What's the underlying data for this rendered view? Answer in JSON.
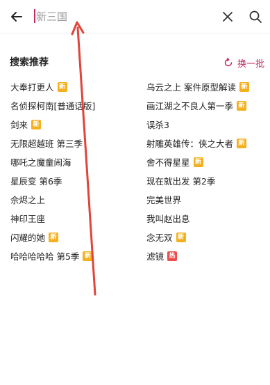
{
  "search": {
    "value": "",
    "placeholder": "新三国"
  },
  "section": {
    "title": "搜索推荐",
    "refresh_label": "换一批"
  },
  "colors": {
    "accent": "#c62860",
    "new_badge": "#f5b01e",
    "hot_badge": "#ef4b4b",
    "annotation_arrow": "#e0443a"
  },
  "recommendations": [
    {
      "left": {
        "title": "大奉打更人",
        "badge": "新"
      },
      "right": {
        "title": "乌云之上 案件原型解读",
        "badge": "新"
      }
    },
    {
      "left": {
        "title": "名侦探柯南[普通话版]",
        "badge": ""
      },
      "right": {
        "title": "画江湖之不良人第一季",
        "badge": "新"
      }
    },
    {
      "left": {
        "title": "剑来",
        "badge": "新"
      },
      "right": {
        "title": "误杀3",
        "badge": ""
      }
    },
    {
      "left": {
        "title": "无限超越班 第三季",
        "badge": ""
      },
      "right": {
        "title": "射雕英雄传：侠之大者",
        "badge": "新"
      }
    },
    {
      "left": {
        "title": "哪吒之魔童闹海",
        "badge": ""
      },
      "right": {
        "title": "舍不得星星",
        "badge": "新"
      }
    },
    {
      "left": {
        "title": "星辰变 第6季",
        "badge": ""
      },
      "right": {
        "title": "现在就出发 第2季",
        "badge": ""
      }
    },
    {
      "left": {
        "title": "佘烬之上",
        "badge": ""
      },
      "right": {
        "title": "完美世界",
        "badge": ""
      }
    },
    {
      "left": {
        "title": "神印王座",
        "badge": ""
      },
      "right": {
        "title": "我叫赵出息",
        "badge": ""
      }
    },
    {
      "left": {
        "title": "闪耀的她",
        "badge": "新"
      },
      "right": {
        "title": "念无双",
        "badge": "新"
      }
    },
    {
      "left": {
        "title": "哈哈哈哈哈 第5季",
        "badge": "新"
      },
      "right": {
        "title": "滤镜",
        "badge": "热"
      }
    }
  ]
}
